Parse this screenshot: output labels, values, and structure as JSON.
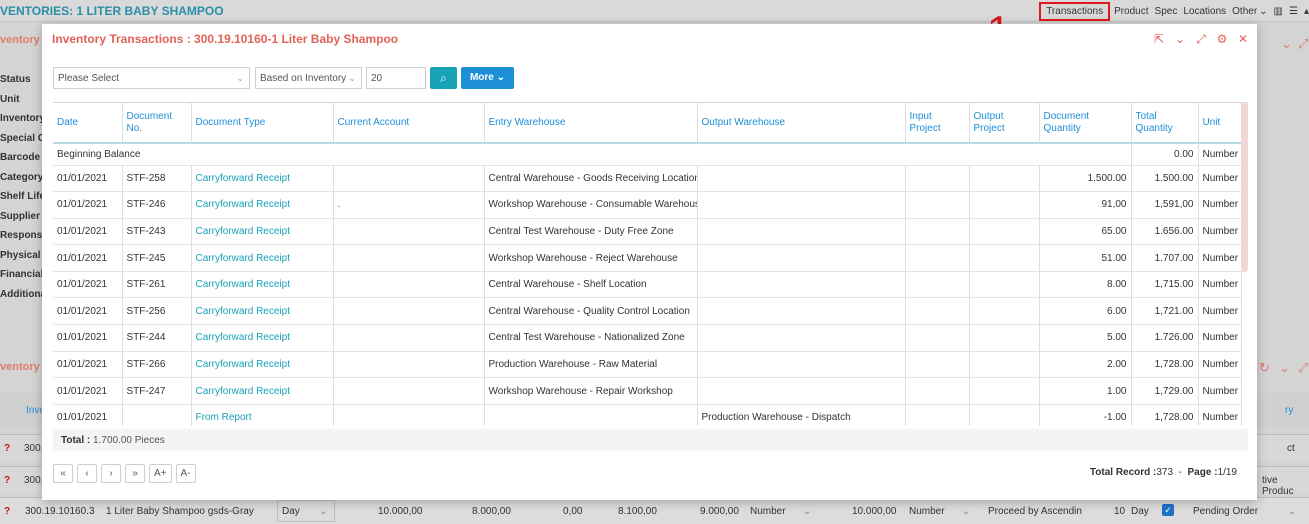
{
  "background": {
    "page_title": "VENTORIES: 1 LITER BABY SHAMPOO",
    "nav": [
      "Transactions",
      "Product",
      "Spec",
      "Locations",
      "Other"
    ],
    "annotation_number": "1",
    "section1": "ventory I",
    "fields": [
      "Status",
      "Unit",
      "Inventory C",
      "Special Co",
      "Barcode",
      "Category",
      "Shelf Life",
      "Supplier",
      "Responsibl",
      "Physical A",
      "Financial A",
      "Additional I"
    ],
    "section2": "ventory S",
    "grid_header_left": "Inve",
    "grid_header_right": "ry",
    "row_partial": [
      "300.",
      "300."
    ],
    "row_right": [
      "ct",
      "tive Produc"
    ],
    "last_row": {
      "code": "300.19.10160.3",
      "name": "1 Liter Baby Shampoo gsds-Gray",
      "unit1": "Day",
      "v1": "10.000,00",
      "v2": "8.000,00",
      "v3": "0,00",
      "v4": "8.100,00",
      "v5": "9.000,00",
      "unit2": "Number",
      "v6": "10.000,00",
      "unit3": "Number",
      "method": "Proceed by Ascendin",
      "days": "10",
      "unit4": "Day",
      "status": "Pending Order"
    }
  },
  "modal": {
    "title": "Inventory Transactions : 300.19.10160-1 Liter Baby Shampoo",
    "filters": {
      "select1": "Please Select",
      "select2": "Based on Inventory",
      "count": "20",
      "more_label": "More"
    },
    "columns": [
      "Date",
      "Document No.",
      "Document Type",
      "Current Account",
      "Entry Warehouse",
      "Output Warehouse",
      "Input Project",
      "Output Project",
      "Document Quantity",
      "Total Quantity",
      "Unit"
    ],
    "beginning": {
      "label": "Beginning Balance",
      "total": "0.00",
      "unit": "Number"
    },
    "rows": [
      {
        "date": "01/01/2021",
        "doc_no": "STF-258",
        "type": "Carryforward Receipt",
        "account": "",
        "entry": "Central Warehouse - Goods Receiving Location",
        "output": "",
        "in_proj": "",
        "out_proj": "",
        "doc_qty": "1.500.00",
        "total": "1.500.00",
        "unit": "Number"
      },
      {
        "date": "01/01/2021",
        "doc_no": "STF-246",
        "type": "Carryforward Receipt",
        "account": ".",
        "entry": "Workshop Warehouse - Consumable Warehouse",
        "output": "",
        "in_proj": "",
        "out_proj": "",
        "doc_qty": "91,00",
        "total": "1,591,00",
        "unit": "Number"
      },
      {
        "date": "01/01/2021",
        "doc_no": "STF-243",
        "type": "Carryforward Receipt",
        "account": "",
        "entry": "Central Test Warehouse - Duty Free Zone",
        "output": "",
        "in_proj": "",
        "out_proj": "",
        "doc_qty": "65.00",
        "total": "1.656.00",
        "unit": "Number"
      },
      {
        "date": "01/01/2021",
        "doc_no": "STF-245",
        "type": "Carryforward Receipt",
        "account": "",
        "entry": "Workshop Warehouse - Reject Warehouse",
        "output": "",
        "in_proj": "",
        "out_proj": "",
        "doc_qty": "51.00",
        "total": "1.707.00",
        "unit": "Number"
      },
      {
        "date": "01/01/2021",
        "doc_no": "STF-261",
        "type": "Carryforward Receipt",
        "account": "",
        "entry": "Central Warehouse - Shelf Location",
        "output": "",
        "in_proj": "",
        "out_proj": "",
        "doc_qty": "8.00",
        "total": "1,715.00",
        "unit": "Number"
      },
      {
        "date": "01/01/2021",
        "doc_no": "STF-256",
        "type": "Carryforward Receipt",
        "account": "",
        "entry": "Central Warehouse - Quality Control Location",
        "output": "",
        "in_proj": "",
        "out_proj": "",
        "doc_qty": "6.00",
        "total": "1,721.00",
        "unit": "Number"
      },
      {
        "date": "01/01/2021",
        "doc_no": "STF-244",
        "type": "Carryforward Receipt",
        "account": "",
        "entry": "Central Test Warehouse - Nationalized Zone",
        "output": "",
        "in_proj": "",
        "out_proj": "",
        "doc_qty": "5.00",
        "total": "1.726.00",
        "unit": "Number"
      },
      {
        "date": "01/01/2021",
        "doc_no": "STF-266",
        "type": "Carryforward Receipt",
        "account": "",
        "entry": "Production Warehouse - Raw Material",
        "output": "",
        "in_proj": "",
        "out_proj": "",
        "doc_qty": "2.00",
        "total": "1,728.00",
        "unit": "Number"
      },
      {
        "date": "01/01/2021",
        "doc_no": "STF-247",
        "type": "Carryforward Receipt",
        "account": "",
        "entry": "Workshop Warehouse - Repair Workshop",
        "output": "",
        "in_proj": "",
        "out_proj": "",
        "doc_qty": "1.00",
        "total": "1,729.00",
        "unit": "Number"
      },
      {
        "date": "01/01/2021",
        "doc_no": "",
        "type": "From Report",
        "account": "",
        "entry": "",
        "output": "Production Warehouse - Dispatch",
        "in_proj": "",
        "out_proj": "",
        "doc_qty": "-1.00",
        "total": "1,728.00",
        "unit": "Number"
      }
    ],
    "total_label": "Total :",
    "total_value": "1.700.00 Pieces",
    "pager": [
      "«",
      "‹",
      "›",
      "»",
      "A+",
      "A-"
    ],
    "record_label": "Total Record :",
    "record_value": "373",
    "page_label": "Page :",
    "page_value": "1/19"
  },
  "colors": {
    "title": "#e2625a",
    "link": "#17a2b8",
    "header": "#1d8fd8",
    "highlight": "#e0191e"
  }
}
